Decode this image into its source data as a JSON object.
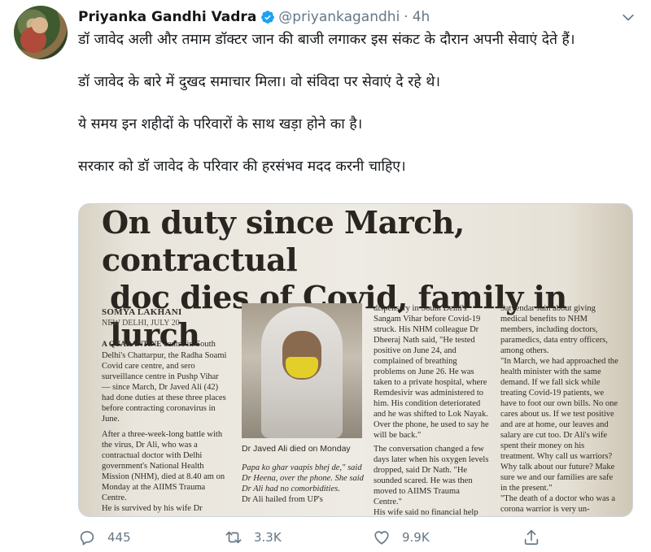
{
  "tweet": {
    "author_name": "Priyanka Gandhi Vadra",
    "handle": "@priyankagandhi",
    "separator": "·",
    "time": "4h",
    "paragraphs": [
      "डॉ जावेद अली और तमाम डॉक्टर जान की बाजी लगाकर इस संकट के दौरान अपनी सेवाएं देते हैं।",
      "डॉ जावेद के बारे में दुखद समाचार मिला। वो संविदा पर सेवाएं दे रहे थे।",
      "ये समय इन शहीदों के परिवारों के साथ खड़ा होने का है।",
      "सरकार को डॉ जावेद के परिवार की हरसंभव मदद करनी चाहिए।"
    ]
  },
  "newspaper": {
    "headline_line1": "On duty since March, contractual",
    "headline_line2": "doc dies of Covid, family in lurch",
    "byline": "SOMYA LAKHANI",
    "dateline": "NEW DELHI, JULY 20",
    "col1_kicker": "A QUARANTINE",
    "col1_text": " centre in South Delhi's Chattarpur, the Radha Soami Covid care centre, and sero surveillance centre in Pushp Vihar — since March, Dr Javed Ali (42) had done duties at these three places before contracting coronavirus in June.",
    "col1_text2": "After a three-week-long battle with the virus, Dr Ali, who was a contractual doctor with Delhi government's National Health Mission (NHM), died at 8.40 am on Monday at the AIIMS Trauma Centre.",
    "col1_text3": "He is survived by his wife Dr",
    "photo_caption": "Dr Javed Ali died on Monday",
    "col2_text": "Papa ko ghar vaapis bhej de,\" said Dr Heena, over the phone. She said Dr Ali had no comorbidities.",
    "col2_text2": "Dr Ali hailed from UP's",
    "col3_text": "dispensary in South Delhi's Sangam Vihar before Covid-19 struck. His NHM colleague Dr Dheeraj Nath said, \"He tested positive on June 24, and complained of breathing problems on June 26. He was taken to a private hospital, where Remdesivir was administered to him. His condition deteriorated and he was shifted to Lok Nayak. Over the phone, he used to say he will be back.\"",
    "col3_text2": "The conversation changed a few days later when his oxygen levels dropped, said Dr Nath. \"He sounded scared. He was then moved to AIIMS Trauma Centre.\"",
    "col3_text3": "His wife said no financial help was extended by the government when Dr Ali was at the private",
    "col4_text": "Satyendar Jain about giving medical benefits to NHM members, including doctors, paramedics, data entry officers, among others.",
    "col4_text2": "\"In March, we had approached the health minister with the same demand. If we fall sick while treating Covid-19 patients, we have to foot our own bills. No one cares about us. If we test positive and are at home, our leaves and salary are cut too. Dr Ali's wife spent their money on his treatment. Why call us warriors? Why talk about our future? Make sure we and our families are safe in the present.\"",
    "col4_text3": "\"The death of a doctor who was a corona warrior is very un-"
  },
  "actions": {
    "reply_count": "445",
    "retweet_count": "3.3K",
    "like_count": "9.9K"
  },
  "colors": {
    "text": "#14171a",
    "secondary": "#657786",
    "verified": "#1da1f2"
  },
  "icons": [
    "verified-badge-icon",
    "chevron-down-icon",
    "reply-icon",
    "retweet-icon",
    "like-icon",
    "share-icon"
  ]
}
